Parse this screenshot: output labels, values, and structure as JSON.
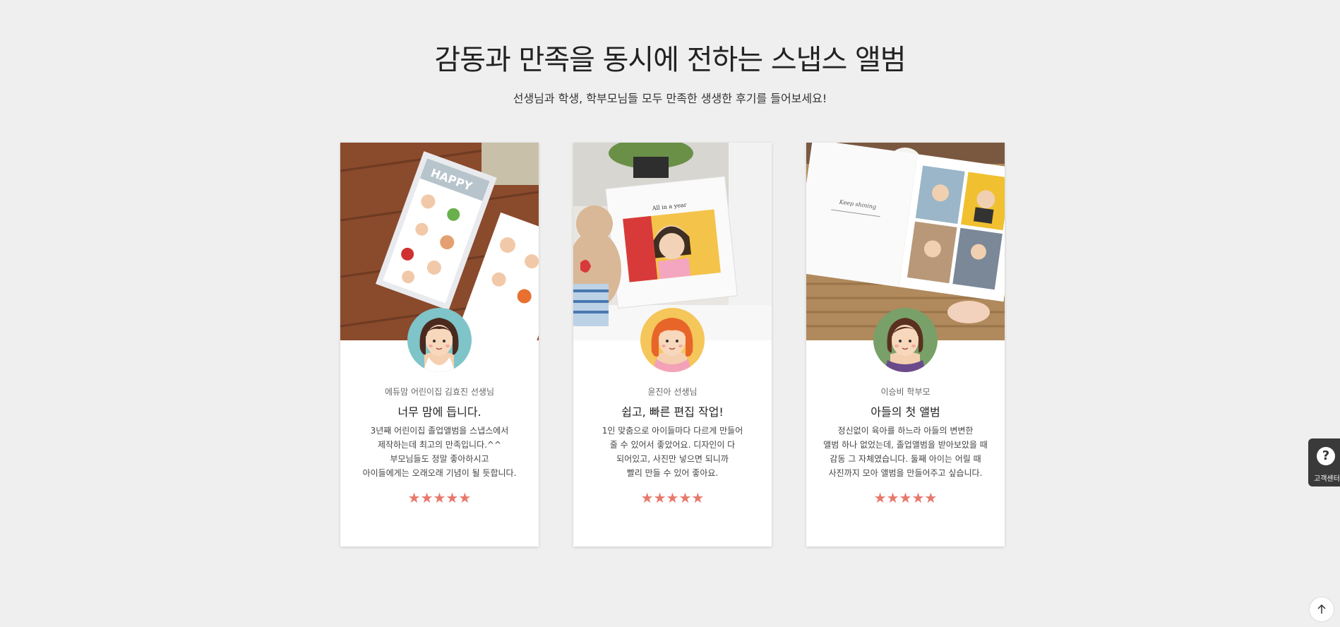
{
  "header": {
    "title": "감동과 만족을 동시에 전하는 스냅스 앨범",
    "subtitle": "선생님과 학생, 학부모님들 모두 만족한 생생한 후기를 들어보세요!"
  },
  "reviews": [
    {
      "reviewer": "에듀맘 어린이집 김효진 선생님",
      "title": "너무 맘에 듭니다.",
      "body": [
        "3년째 어린이집 졸업앨범을 스냅스에서",
        "제작하는데 최고의 만족입니다.^^",
        "부모님들도 정말 좋아하시고",
        "아이들에게는 오래오래 기념이 될 듯합니다."
      ],
      "rating": 5,
      "stars": "★★★★★",
      "photo_icon": "album-photo-happy",
      "avatar_icon": "teacher-avatar-teal"
    },
    {
      "reviewer": "윤진아 선생님",
      "title": "쉽고, 빠른 편집 작업!",
      "body": [
        "1인 맞춤으로 아이들마다 다르게 만들어",
        "줄 수 있어서 좋았어요. 디자인이 다",
        "되어있고, 사진만 넣으면 되니까",
        "빨리 만들 수 있어 좋아요."
      ],
      "rating": 5,
      "stars": "★★★★★",
      "photo_icon": "album-photo-all-in-a-year",
      "avatar_icon": "teacher-avatar-yellow"
    },
    {
      "reviewer": "이승비 학부모",
      "title": "아들의 첫 앨범",
      "body": [
        "정신없이 육아를 하느라 아들의 변변한",
        "앨범 하나 없었는데, 졸업앨범을 받아보았을 때",
        "감동 그 자체였습니다. 둘째 아이는 어릴 때",
        "사진까지 모아 앨범을 만들어주고 싶습니다."
      ],
      "rating": 5,
      "stars": "★★★★★",
      "photo_icon": "album-photo-keep-shining",
      "avatar_icon": "parent-avatar-green"
    }
  ],
  "help_widget": {
    "label": "고객센터",
    "glyph": "?"
  },
  "scroll_top": {
    "icon": "arrow-up-icon"
  },
  "colors": {
    "star": "#e8786b",
    "background": "#efefef"
  }
}
